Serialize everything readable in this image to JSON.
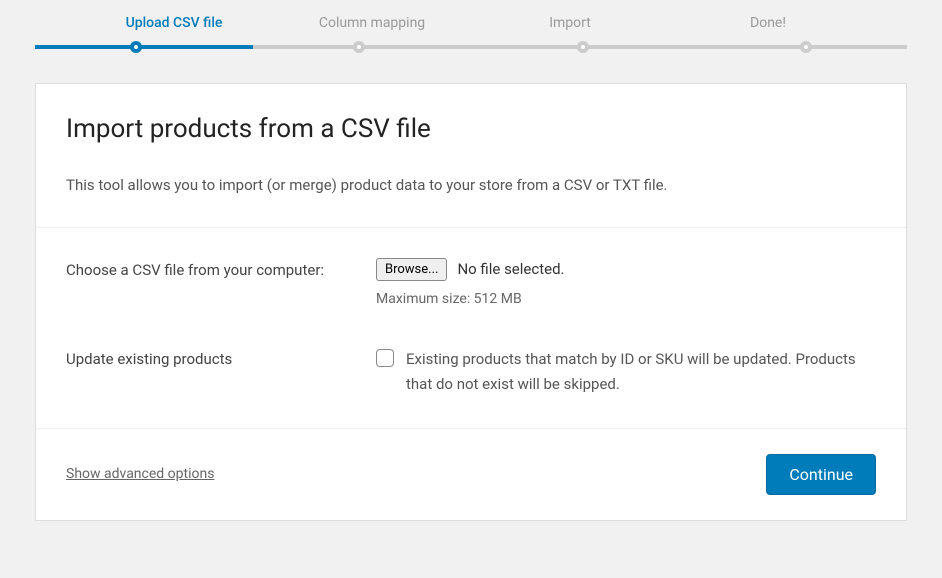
{
  "stepper": {
    "steps": [
      {
        "label": "Upload CSV file",
        "active": true
      },
      {
        "label": "Column mapping",
        "active": false
      },
      {
        "label": "Import",
        "active": false
      },
      {
        "label": "Done!",
        "active": false
      }
    ]
  },
  "header": {
    "title": "Import products from a CSV file",
    "description": "This tool allows you to import (or merge) product data to your store from a CSV or TXT file."
  },
  "form": {
    "file": {
      "label": "Choose a CSV file from your computer:",
      "browse_button": "Browse...",
      "status": "No file selected.",
      "hint": "Maximum size: 512 MB"
    },
    "update": {
      "label": "Update existing products",
      "checkbox_text": "Existing products that match by ID or SKU will be updated. Products that do not exist will be skipped."
    }
  },
  "footer": {
    "advanced_link": "Show advanced options",
    "continue_button": "Continue"
  }
}
